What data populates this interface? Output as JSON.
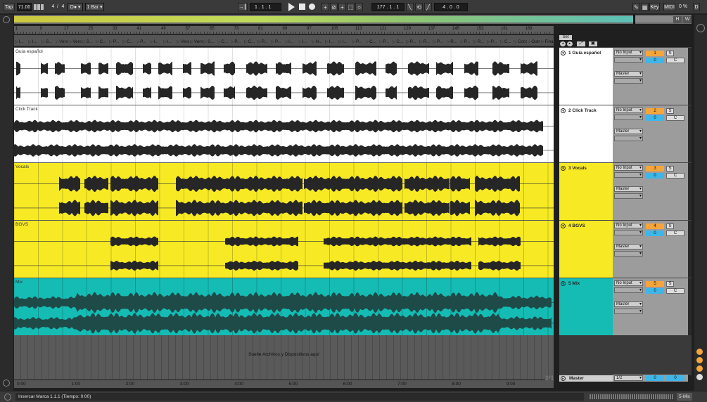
{
  "transport": {
    "tap": "Tap",
    "tempo": "71.00",
    "sig_num": "4",
    "sig_den": "4",
    "metronome": "O●",
    "quantize": "1 Bar",
    "pos_a": "1",
    "pos_b": "1",
    "pos_c": "1",
    "loop_a": "177",
    "loop_b": "1",
    "loop_c": "1",
    "len_a": "4",
    "len_b": "0",
    "len_c": "0",
    "key": "Key",
    "midi": "MIDI",
    "cpu": "0 %",
    "d": "D",
    "h": "H",
    "w": "W"
  },
  "ruler": {
    "bars": [
      "1",
      "9",
      "17",
      "25",
      "33",
      "41",
      "49",
      "57",
      "65",
      "73",
      "81",
      "89",
      "97",
      "105",
      "113",
      "121",
      "129",
      "137",
      "145",
      "153",
      "161",
      "169"
    ]
  },
  "locators": [
    "I...",
    "I...",
    "S...",
    "Verso",
    "Verso",
    "S...",
    "C...",
    "P...",
    "C...",
    "P...",
    "I...",
    "I...",
    "Verso",
    "Verso",
    "S...",
    "C...",
    "P...",
    "C...",
    "P...",
    "P...",
    "I...",
    "I...",
    "H...",
    "I...",
    "I...",
    "P...",
    "C...",
    "P...",
    "C...",
    "P...",
    "R...",
    "P...",
    "R...",
    "P...",
    "R...",
    "P...",
    "C...",
    "Coro out",
    "Outro",
    "Final"
  ],
  "set_label": "Set",
  "tracks": [
    {
      "lane_name": "Guía español",
      "header": "1 Guía español",
      "num": "1",
      "input": "No Input",
      "output": "Master",
      "vol": "0",
      "color": "#ffffff"
    },
    {
      "lane_name": "Click Track",
      "header": "2 Click Track",
      "num": "2",
      "input": "No Input",
      "output": "Master",
      "vol": "0",
      "color": "#ffffff"
    },
    {
      "lane_name": "Vocals",
      "header": "3 Vocals",
      "num": "3",
      "input": "No Input",
      "output": "Master",
      "vol": "0",
      "color": "#f7ea24"
    },
    {
      "lane_name": "BGVS",
      "header": "4 BGVS",
      "num": "4",
      "input": "No Input",
      "output": "Master",
      "vol": "0",
      "color": "#f7ea24"
    },
    {
      "lane_name": "Mix",
      "header": "5 Mix",
      "num": "5",
      "input": "No Input",
      "output": "Master",
      "vol": "0",
      "color": "#15bcb4"
    }
  ],
  "solo": "S",
  "cue": "C",
  "drop_text": "Suelte Archivos y Dispositivos aquí",
  "master": {
    "label": "Master",
    "routing": "1/2",
    "vol": "0",
    "pan": "0"
  },
  "zoom": "2/1",
  "timeline": [
    "0:00",
    "1:00",
    "2:00",
    "3:00",
    "4:00",
    "5:00",
    "6:00",
    "7:00",
    "8:00",
    "9:00"
  ],
  "status_text": "Insercar Marca 1.1.1 (Tiempo: 0:00)",
  "status_right": "5-Mix"
}
